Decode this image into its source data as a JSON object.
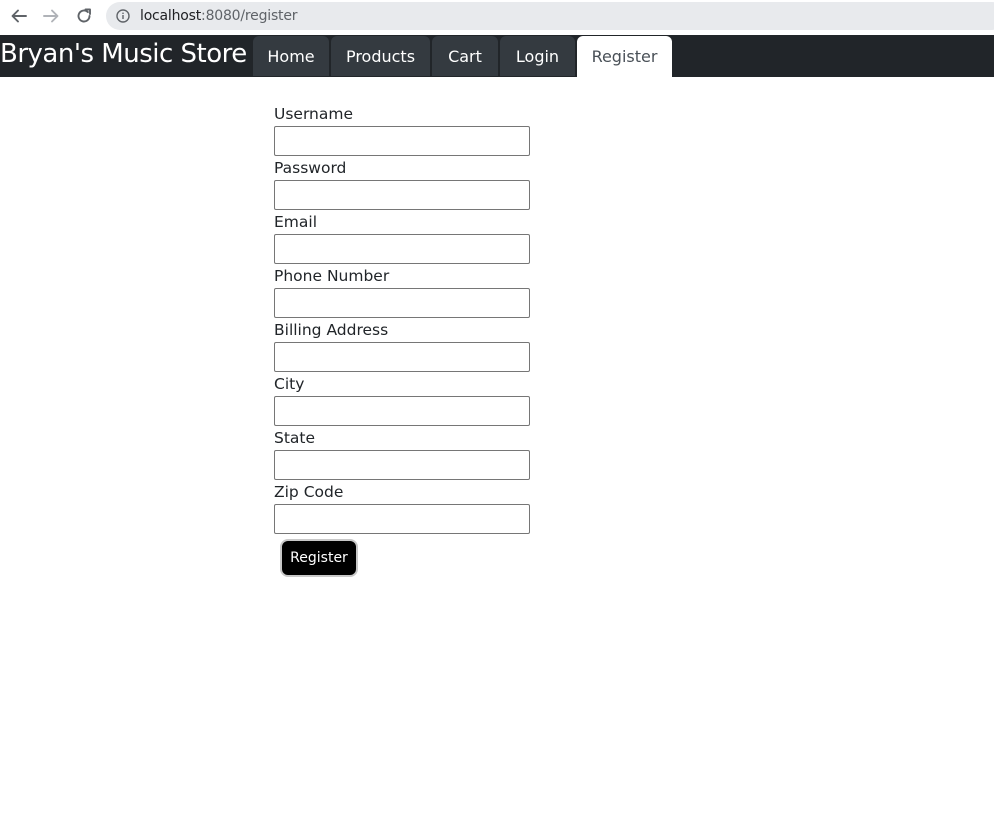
{
  "browser": {
    "url_host": "localhost",
    "url_rest": ":8080/register",
    "icons": {
      "back": "arrow-left-icon",
      "forward": "arrow-right-icon",
      "reload": "reload-icon",
      "info": "info-icon"
    }
  },
  "header": {
    "brand": "Bryan's Music Store",
    "background_color": "#212529",
    "tab_color": "#343a40",
    "active_tab_color": "#ffffff",
    "tabs": [
      {
        "label": "Home",
        "active": false
      },
      {
        "label": "Products",
        "active": false
      },
      {
        "label": "Cart",
        "active": false
      },
      {
        "label": "Login",
        "active": false
      },
      {
        "label": "Register",
        "active": true
      }
    ]
  },
  "form": {
    "fields": [
      {
        "label": "Username",
        "value": ""
      },
      {
        "label": "Password",
        "value": ""
      },
      {
        "label": "Email",
        "value": ""
      },
      {
        "label": "Phone Number",
        "value": ""
      },
      {
        "label": "Billing Address",
        "value": ""
      },
      {
        "label": "City",
        "value": ""
      },
      {
        "label": "State",
        "value": ""
      },
      {
        "label": "Zip Code",
        "value": ""
      }
    ],
    "submit_label": "Register",
    "submit_color": "#000000"
  }
}
